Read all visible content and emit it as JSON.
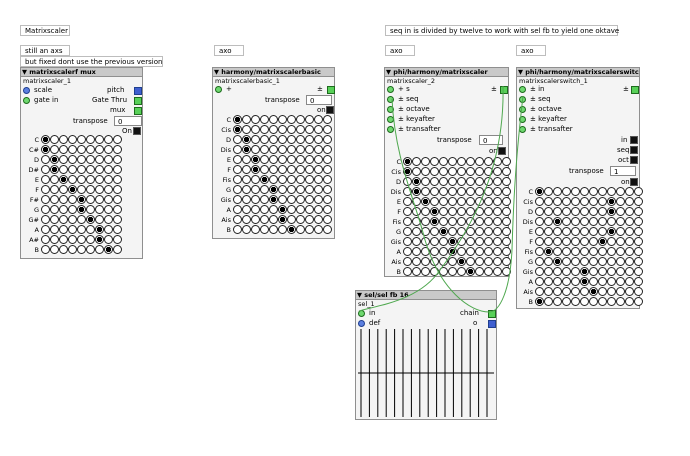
{
  "comments": {
    "title": "Matrixscaler",
    "still_an_axs": "still an axs",
    "fixed_note": "but fixed dont use the previous version",
    "axo1": "axo",
    "seq_note": "seq in is divided by twelve to work with sel fb to yield one oktave",
    "axo2": "axo",
    "axo3": "axo"
  },
  "obj1": {
    "title": "matrixscalerf mux",
    "instance": "matrixscaler_1",
    "in_scale": "scale",
    "in_gate": "gate in",
    "out_pitch": "pitch",
    "out_gatethru": "Gate Thru",
    "mux_label": "mux",
    "transpose_label": "transpose",
    "transpose_value": "0",
    "on_label": "On",
    "notes": [
      "C",
      "C#",
      "D",
      "D#",
      "E",
      "F",
      "F#",
      "G",
      "G#",
      "A",
      "A#",
      "B"
    ],
    "active": [
      0,
      0,
      1,
      1,
      2,
      3,
      4,
      4,
      5,
      6,
      6,
      7
    ]
  },
  "obj2": {
    "title": "harmony/matrixscalerbasic",
    "instance": "matrixscalerbasic_1",
    "in_plus": "+",
    "pm": "±",
    "transpose_label": "transpose",
    "transpose_value": "0",
    "on_label": "on",
    "notes": [
      "C",
      "Cis",
      "D",
      "Dis",
      "E",
      "F",
      "Fis",
      "G",
      "Gis",
      "A",
      "Ais",
      "B"
    ],
    "active": [
      0,
      0,
      1,
      1,
      2,
      2,
      3,
      4,
      4,
      5,
      5,
      6
    ]
  },
  "obj3": {
    "title": "phi/harmony/matrixscaler",
    "instance": "matrixscaler_2",
    "inlets": [
      "s",
      "seq",
      "octave",
      "keyafter",
      "transafter"
    ],
    "in_plus": "+",
    "pm": "±",
    "transpose_label": "transpose",
    "transpose_value": "0",
    "on_label": "on",
    "notes": [
      "C",
      "Cis",
      "D",
      "Dis",
      "E",
      "F",
      "Fis",
      "G",
      "Gis",
      "A",
      "Ais",
      "B"
    ],
    "active": [
      0,
      0,
      1,
      1,
      2,
      3,
      3,
      4,
      5,
      5,
      6,
      7
    ]
  },
  "obj4": {
    "title": "phi/harmony/matrixscalerswitch",
    "instance": "matrixscalerswitch_1",
    "inlets": [
      "in",
      "seq",
      "octave",
      "keyafter",
      "transafter"
    ],
    "pm": "±",
    "in_label": "in",
    "seq_label": "seq",
    "oct_label": "oct",
    "transpose_label": "transpose",
    "transpose_value": "1",
    "on_label": "on",
    "notes": [
      "C",
      "Cis",
      "D",
      "Dis",
      "E",
      "F",
      "Fis",
      "G",
      "Gis",
      "A",
      "Ais",
      "B"
    ],
    "active": [
      0,
      8,
      8,
      2,
      8,
      7,
      1,
      2,
      5,
      5,
      6,
      0
    ]
  },
  "obj5": {
    "title": "sel/sel fb 16",
    "instance": "sel_1",
    "in_label": "in",
    "def_label": "def",
    "out_chain": "chain",
    "out_o": "o",
    "steps": 16
  },
  "colors": {
    "wire": "#4fa84f",
    "title_bg": "#c9c9c9",
    "panel_bg": "#f4f4f4"
  }
}
